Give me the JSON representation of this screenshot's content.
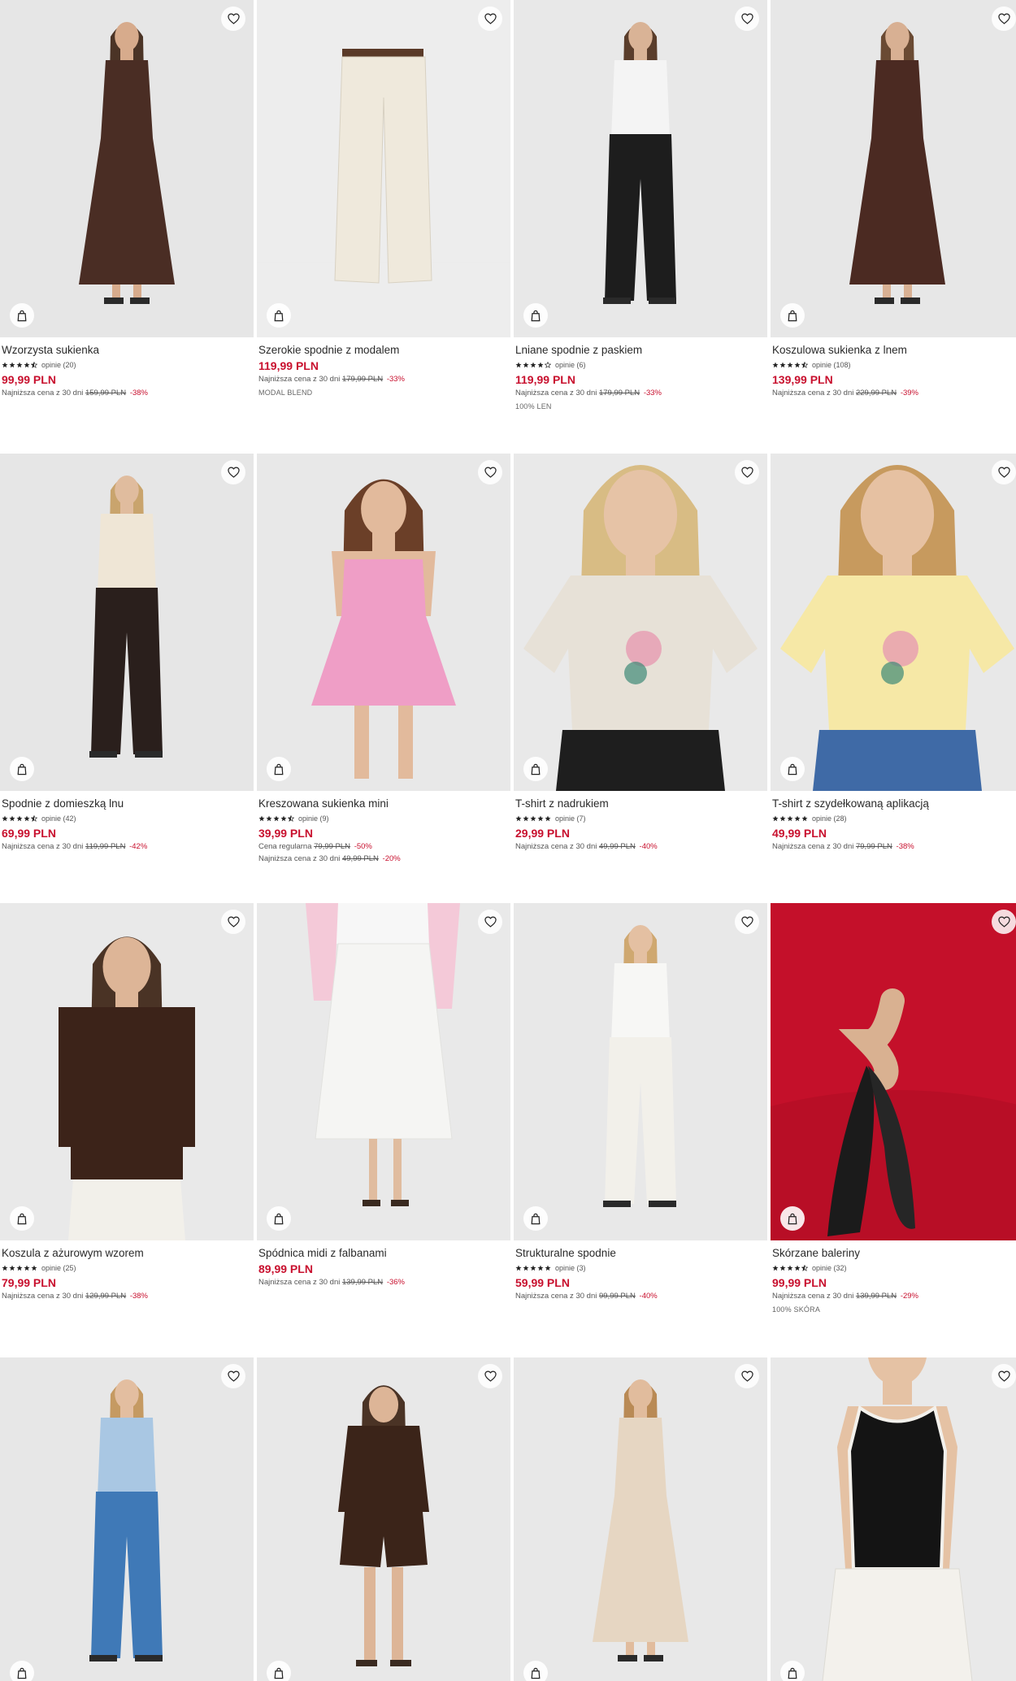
{
  "ui": {
    "colors": {
      "price": "#c8102e",
      "text": "#2a2a2a",
      "muted": "#555555",
      "photo_bg": "#ececec"
    },
    "icons": {
      "favorite": "heart-icon",
      "cart": "shopping-bag-icon",
      "rating": "star-icon"
    }
  },
  "products": [
    {
      "title": "Wzorzysta sukienka",
      "stars": 4.5,
      "opinions": "opinie (20)",
      "price": "99,99 PLN",
      "lines": [
        {
          "label": "Najniższa cena z 30 dni",
          "old": "159,99 PLN",
          "disc": "-38%"
        }
      ],
      "note": "",
      "art": {
        "bg": "#e6e6e6",
        "top": "#4a2d24",
        "bottom": "#4a2d24",
        "skin": "#d7ab8c",
        "hair": "#4b3426",
        "kind": "dress"
      }
    },
    {
      "title": "Szerokie spodnie z modalem",
      "stars": 0,
      "opinions": "",
      "price": "119,99 PLN",
      "lines": [
        {
          "label": "Najniższa cena z 30 dni",
          "old": "179,99 PLN",
          "disc": "-33%"
        }
      ],
      "note": "MODAL BLEND",
      "art": {
        "bg": "#ededed",
        "top": "#ededed",
        "bottom": "#efe9dc",
        "skin": "#ededed",
        "hair": "#ededed",
        "kind": "pants"
      }
    },
    {
      "title": "Lniane spodnie z paskiem",
      "stars": 4,
      "opinions": "opinie (6)",
      "price": "119,99 PLN",
      "lines": [
        {
          "label": "Najniższa cena z 30 dni",
          "old": "179,99 PLN",
          "disc": "-33%"
        }
      ],
      "note": "100% LEN",
      "art": {
        "bg": "#e8e8e8",
        "top": "#f4f4f4",
        "bottom": "#1d1d1d",
        "skin": "#d9b396",
        "hair": "#5a3d2b",
        "kind": "outfit"
      }
    },
    {
      "title": "Koszulowa sukienka z lnem",
      "stars": 4.5,
      "opinions": "opinie (108)",
      "price": "139,99 PLN",
      "lines": [
        {
          "label": "Najniższa cena z 30 dni",
          "old": "229,99 PLN",
          "disc": "-39%"
        }
      ],
      "note": "",
      "art": {
        "bg": "#e7e7e7",
        "top": "#4b2a22",
        "bottom": "#4b2a22",
        "skin": "#d8b093",
        "hair": "#6a4a33",
        "kind": "dress"
      }
    },
    {
      "title": "Spodnie z domieszką lnu",
      "stars": 4.5,
      "opinions": "opinie (42)",
      "price": "69,99 PLN",
      "lines": [
        {
          "label": "Najniższa cena z 30 dni",
          "old": "119,99 PLN",
          "disc": "-42%"
        }
      ],
      "note": "",
      "art": {
        "bg": "#e6e6e6",
        "top": "#efe6d6",
        "bottom": "#2a1f1c",
        "skin": "#e0bc9e",
        "hair": "#c9a46d",
        "kind": "outfit"
      }
    },
    {
      "title": "Kreszowana sukienka mini",
      "stars": 4.5,
      "opinions": "opinie (9)",
      "price": "39,99 PLN",
      "lines": [
        {
          "label": "Cena regularna",
          "old": "79,99 PLN",
          "disc": "-50%"
        },
        {
          "label": "Najniższa cena z 30 dni",
          "old": "49,99 PLN",
          "disc": "-20%"
        }
      ],
      "note": "",
      "art": {
        "bg": "#e8e8e8",
        "top": "#ef9ec6",
        "bottom": "#ef9ec6",
        "skin": "#e2ba9c",
        "hair": "#6b3f28",
        "kind": "mini"
      }
    },
    {
      "title": "T-shirt z nadrukiem",
      "stars": 5,
      "opinions": "opinie (7)",
      "price": "29,99 PLN",
      "lines": [
        {
          "label": "Najniższa cena z 30 dni",
          "old": "49,99 PLN",
          "disc": "-40%"
        }
      ],
      "note": "",
      "art": {
        "bg": "#e9e9e9",
        "top": "#e7e1d7",
        "bottom": "#1e1e1e",
        "skin": "#e6c3a6",
        "hair": "#d8bc84",
        "kind": "tee"
      }
    },
    {
      "title": "T-shirt z szydełkowaną aplikacją",
      "stars": 5,
      "opinions": "opinie (28)",
      "price": "49,99 PLN",
      "lines": [
        {
          "label": "Najniższa cena z 30 dni",
          "old": "79,99 PLN",
          "disc": "-38%"
        }
      ],
      "note": "",
      "art": {
        "bg": "#e8e8e8",
        "top": "#f6e8a6",
        "bottom": "#3f6aa6",
        "skin": "#e6c1a2",
        "hair": "#c79a5e",
        "kind": "tee"
      }
    },
    {
      "title": "Koszula z ażurowym wzorem",
      "stars": 5,
      "opinions": "opinie (25)",
      "price": "79,99 PLN",
      "lines": [
        {
          "label": "Najniższa cena z 30 dni",
          "old": "129,99 PLN",
          "disc": "-38%"
        }
      ],
      "note": "",
      "art": {
        "bg": "#e9e9e9",
        "top": "#3c2319",
        "bottom": "#f2f0ea",
        "skin": "#ddb597",
        "hair": "#4a3325",
        "kind": "shirt"
      }
    },
    {
      "title": "Spódnica midi z falbanami",
      "stars": 0,
      "opinions": "",
      "price": "89,99 PLN",
      "lines": [
        {
          "label": "Najniższa cena z 30 dni",
          "old": "139,99 PLN",
          "disc": "-36%"
        }
      ],
      "note": "",
      "art": {
        "bg": "#e9e9e9",
        "top": "#f4c9d8",
        "bottom": "#f5f5f3",
        "skin": "#e0bc9f",
        "hair": "#e9e9e9",
        "kind": "skirt"
      }
    },
    {
      "title": "Strukturalne spodnie",
      "stars": 5,
      "opinions": "opinie (3)",
      "price": "59,99 PLN",
      "lines": [
        {
          "label": "Najniższa cena z 30 dni",
          "old": "99,99 PLN",
          "disc": "-40%"
        }
      ],
      "note": "",
      "art": {
        "bg": "#e8e8e8",
        "top": "#f7f7f5",
        "bottom": "#f2f0ea",
        "skin": "#e4c0a2",
        "hair": "#cfa870",
        "kind": "outfit"
      }
    },
    {
      "title": "Skórzane baleriny",
      "stars": 4.5,
      "opinions": "opinie (32)",
      "price": "99,99 PLN",
      "lines": [
        {
          "label": "Najniższa cena z 30 dni",
          "old": "139,99 PLN",
          "disc": "-29%"
        }
      ],
      "note": "100% SKÓRA",
      "art": {
        "bg": "#c4102a",
        "top": "#c4102a",
        "bottom": "#1b1b1b",
        "skin": "#d9b191",
        "hair": "#c4102a",
        "kind": "shoes"
      }
    },
    {
      "title": "",
      "stars": 0,
      "opinions": "",
      "price": "",
      "lines": [],
      "note": "",
      "art": {
        "bg": "#e7e7e7",
        "top": "#a9c7e3",
        "bottom": "#3f79b7",
        "skin": "#e3bea0",
        "hair": "#c59a62",
        "kind": "outfit"
      }
    },
    {
      "title": "",
      "stars": 0,
      "opinions": "",
      "price": "",
      "lines": [],
      "note": "",
      "art": {
        "bg": "#e8e8e8",
        "top": "#3b2419",
        "bottom": "#3b2419",
        "skin": "#ddb597",
        "hair": "#4a3325",
        "kind": "shorts"
      }
    },
    {
      "title": "",
      "stars": 0,
      "opinions": "",
      "price": "",
      "lines": [],
      "note": "",
      "art": {
        "bg": "#e8e8e8",
        "top": "#e6d6c2",
        "bottom": "#e6d6c2",
        "skin": "#e1bc9d",
        "hair": "#b98a55",
        "kind": "dress"
      }
    },
    {
      "title": "",
      "stars": 0,
      "opinions": "",
      "price": "",
      "lines": [],
      "note": "",
      "art": {
        "bg": "#e9e9e9",
        "top": "#141414",
        "bottom": "#f3f1ec",
        "skin": "#e5c2a4",
        "hair": "#e9e9e9",
        "kind": "tank"
      }
    }
  ]
}
